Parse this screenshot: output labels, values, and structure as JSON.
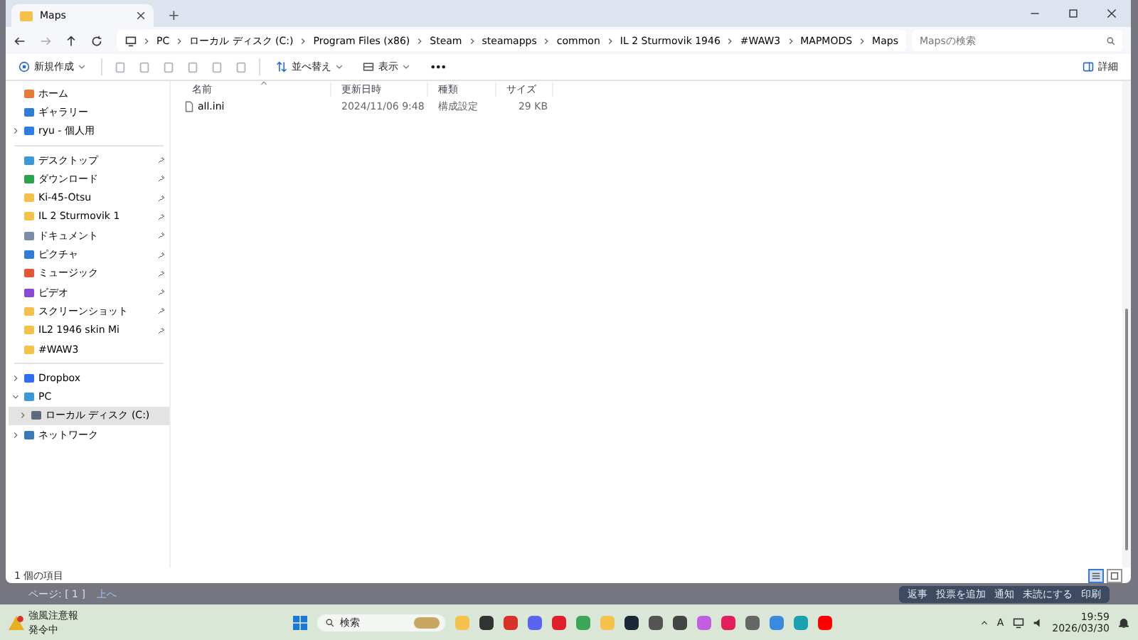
{
  "window": {
    "tab_title": "Maps",
    "new_tab": "+"
  },
  "address": {
    "breadcrumbs": [
      "PC",
      "ローカル ディスク (C:)",
      "Program Files (x86)",
      "Steam",
      "steamapps",
      "common",
      "IL 2 Sturmovik 1946",
      "#WAW3",
      "MAPMODS",
      "Maps"
    ],
    "search": {
      "placeholder": "Mapsの検索"
    }
  },
  "toolbar": {
    "new": "新規作成",
    "sort": "並べ替え",
    "view": "表示",
    "more": "•••",
    "details": "詳細"
  },
  "sidebar": {
    "groups": [
      [
        {
          "label": "ホーム",
          "pinned": false,
          "expandable": false,
          "expanded": false,
          "selected": false
        },
        {
          "label": "ギャラリー",
          "pinned": false,
          "expandable": false,
          "expanded": false,
          "selected": false
        },
        {
          "label": "ryu - 個人用",
          "pinned": false,
          "expandable": true,
          "expanded": false,
          "selected": false
        }
      ],
      [
        {
          "label": "デスクトップ",
          "pinned": true,
          "expandable": false,
          "expanded": false,
          "selected": false
        },
        {
          "label": "ダウンロード",
          "pinned": true,
          "expandable": false,
          "expanded": false,
          "selected": false
        },
        {
          "label": "Ki-45-Otsu",
          "pinned": true,
          "expandable": false,
          "expanded": false,
          "selected": false
        },
        {
          "label": "IL 2 Sturmovik 1",
          "pinned": true,
          "expandable": false,
          "expanded": false,
          "selected": false
        },
        {
          "label": "ドキュメント",
          "pinned": true,
          "expandable": false,
          "expanded": false,
          "selected": false
        },
        {
          "label": "ピクチャ",
          "pinned": true,
          "expandable": false,
          "expanded": false,
          "selected": false
        },
        {
          "label": "ミュージック",
          "pinned": true,
          "expandable": false,
          "expanded": false,
          "selected": false
        },
        {
          "label": "ビデオ",
          "pinned": true,
          "expandable": false,
          "expanded": false,
          "selected": false
        },
        {
          "label": "スクリーンショット",
          "pinned": true,
          "expandable": false,
          "expanded": false,
          "selected": false
        },
        {
          "label": "IL2 1946 skin Mi",
          "pinned": true,
          "expandable": false,
          "expanded": false,
          "selected": false
        },
        {
          "label": "#WAW3",
          "pinned": false,
          "expandable": false,
          "expanded": false,
          "selected": false
        }
      ],
      [
        {
          "label": "Dropbox",
          "pinned": false,
          "expandable": true,
          "expanded": false,
          "selected": false
        },
        {
          "label": "PC",
          "pinned": false,
          "expandable": true,
          "expanded": true,
          "selected": false,
          "children": [
            {
              "label": "ローカル ディスク (C:)",
              "pinned": false,
              "expandable": true,
              "expanded": false,
              "selected": true
            }
          ]
        },
        {
          "label": "ネットワーク",
          "pinned": false,
          "expandable": true,
          "expanded": false,
          "selected": false
        }
      ]
    ]
  },
  "table": {
    "columns": [
      "名前",
      "更新日時",
      "種類",
      "サイズ"
    ],
    "rows": [
      {
        "name": "all.ini",
        "modified": "2024/11/06 9:48",
        "type": "構成設定",
        "size": "29 KB"
      }
    ]
  },
  "status_bar": {
    "count": "1 個の項目",
    "views": [
      {
        "kind": "details",
        "selected": true
      },
      {
        "kind": "tiles",
        "selected": false
      }
    ]
  },
  "background_page": {
    "pager": "ページ: [ 1 ]",
    "top_link": "上へ",
    "buttons": [
      "返事",
      "投票を追加",
      "通知",
      "未読にする",
      "印刷"
    ]
  },
  "taskbar": {
    "weather": {
      "title": "強風注意報",
      "subtitle": "発令中"
    },
    "search": "検索",
    "ime": "A",
    "time": "19:59",
    "date": "2026/03/30"
  }
}
